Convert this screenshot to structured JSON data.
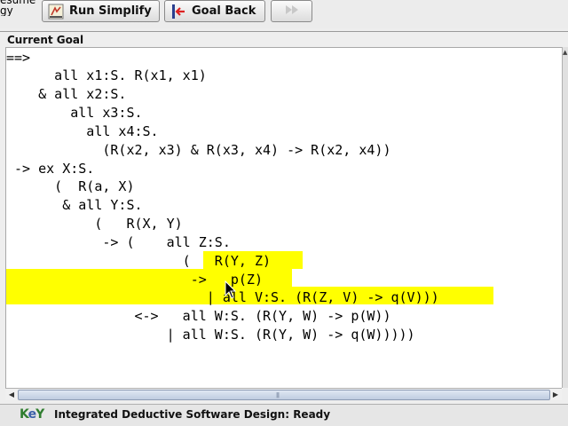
{
  "toolbar": {
    "resume_text": [
      "esume",
      "gy"
    ],
    "run_simplify": "Run Simplify",
    "goal_back": "Goal Back",
    "disabled_icon": "fast-forward-icon"
  },
  "goal_panel": {
    "title": "Current Goal",
    "lines": [
      "==>",
      "      all x1:S. R(x1, x1)",
      "    & all x2:S.",
      "        all x3:S.",
      "          all x4:S.",
      "            (R(x2, x3) & R(x3, x4) -> R(x2, x4))",
      " -> ex X:S.",
      "      (  R(a, X)",
      "       & all Y:S.",
      "           (   R(X, Y)",
      "            -> (    all Z:S.",
      "                      (   R(Y, Z)",
      "                       ->   p(Z)",
      "                         | all V:S. (R(Z, V) -> q(V)))",
      "                <->   all W:S. (R(Y, W) -> p(W))",
      "                    | all W:S. (R(Y, W) -> q(W)))))"
    ],
    "highlight_color": "#ffff00"
  },
  "status": {
    "logo": "KeY",
    "text": "Integrated Deductive Software Design: Ready"
  }
}
